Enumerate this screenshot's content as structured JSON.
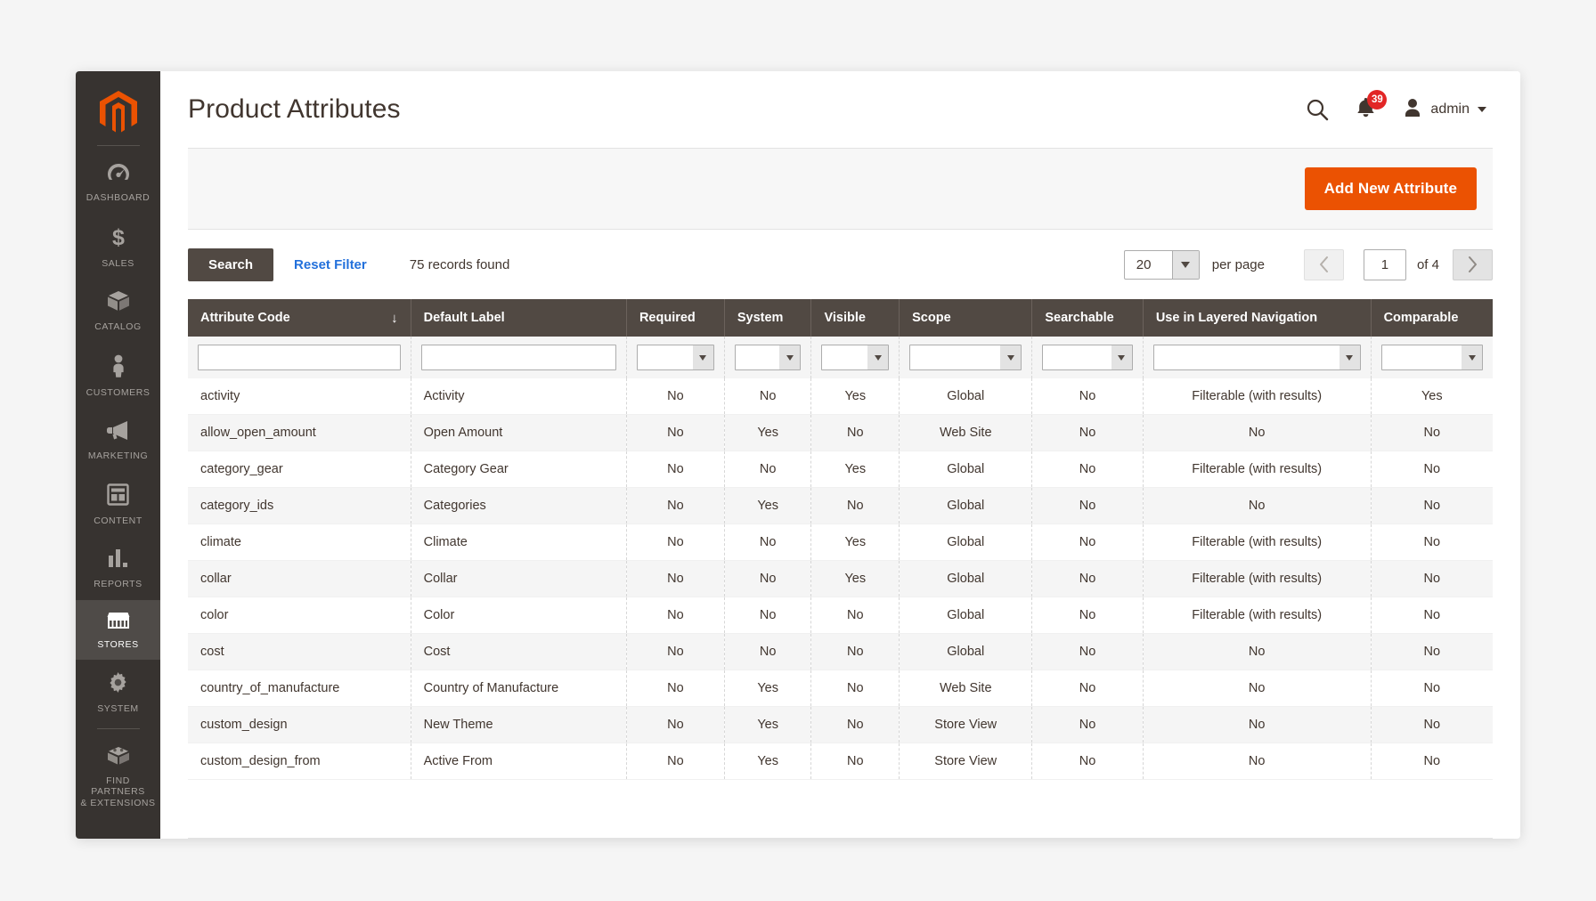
{
  "app": {
    "logo_icon": "magento-logo",
    "accent_color": "#eb5202",
    "sidebar_bg": "#373330",
    "header_bg": "#514943"
  },
  "sidebar": {
    "items": [
      {
        "label": "DASHBOARD",
        "icon": "dashboard-gauge-icon",
        "active": false
      },
      {
        "label": "SALES",
        "icon": "dollar-sign-icon",
        "active": false
      },
      {
        "label": "CATALOG",
        "icon": "box-icon",
        "active": false
      },
      {
        "label": "CUSTOMERS",
        "icon": "person-icon",
        "active": false
      },
      {
        "label": "MARKETING",
        "icon": "megaphone-icon",
        "active": false
      },
      {
        "label": "CONTENT",
        "icon": "layout-window-icon",
        "active": false
      },
      {
        "label": "REPORTS",
        "icon": "bar-chart-icon",
        "active": false
      },
      {
        "label": "STORES",
        "icon": "storefront-icon",
        "active": true
      },
      {
        "label": "SYSTEM",
        "icon": "gear-icon",
        "active": false
      },
      {
        "label": "FIND PARTNERS\n& EXTENSIONS",
        "icon": "puzzle-block-icon",
        "active": false
      }
    ],
    "find_partners_line1": "FIND PARTNERS",
    "find_partners_line2": "& EXTENSIONS"
  },
  "header": {
    "title": "Product Attributes",
    "search_icon": "search-icon",
    "notifications_icon": "bell-icon",
    "notifications_count": "39",
    "user_icon": "user-avatar-icon",
    "user_name": "admin",
    "user_caret_icon": "chevron-down-icon"
  },
  "toolbar": {
    "add_new_attribute_label": "Add New Attribute"
  },
  "grid_controls": {
    "search_label": "Search",
    "reset_filter_label": "Reset Filter",
    "records_found": "75 records found",
    "per_page_value": "20",
    "per_page_label": "per page",
    "prev_icon": "chevron-left-icon",
    "next_icon": "chevron-right-icon",
    "page_value": "1",
    "of_pages": "of 4"
  },
  "grid": {
    "columns": [
      {
        "label": "Attribute Code",
        "sorted": true,
        "sort_icon": "arrow-down-icon",
        "filter_type": "text",
        "align": "left"
      },
      {
        "label": "Default Label",
        "sorted": false,
        "filter_type": "text",
        "align": "left"
      },
      {
        "label": "Required",
        "sorted": false,
        "filter_type": "select",
        "align": "center"
      },
      {
        "label": "System",
        "sorted": false,
        "filter_type": "select",
        "align": "center"
      },
      {
        "label": "Visible",
        "sorted": false,
        "filter_type": "select",
        "align": "center"
      },
      {
        "label": "Scope",
        "sorted": false,
        "filter_type": "select",
        "align": "center"
      },
      {
        "label": "Searchable",
        "sorted": false,
        "filter_type": "select",
        "align": "center"
      },
      {
        "label": "Use in Layered Navigation",
        "sorted": false,
        "filter_type": "select",
        "align": "center"
      },
      {
        "label": "Comparable",
        "sorted": false,
        "filter_type": "select",
        "align": "center"
      }
    ],
    "filter_values": [
      "",
      "",
      "",
      "",
      "",
      "",
      "",
      "",
      ""
    ],
    "rows": [
      [
        "activity",
        "Activity",
        "No",
        "No",
        "Yes",
        "Global",
        "No",
        "Filterable (with results)",
        "Yes"
      ],
      [
        "allow_open_amount",
        "Open Amount",
        "No",
        "Yes",
        "No",
        "Web Site",
        "No",
        "No",
        "No"
      ],
      [
        "category_gear",
        "Category Gear",
        "No",
        "No",
        "Yes",
        "Global",
        "No",
        "Filterable (with results)",
        "No"
      ],
      [
        "category_ids",
        "Categories",
        "No",
        "Yes",
        "No",
        "Global",
        "No",
        "No",
        "No"
      ],
      [
        "climate",
        "Climate",
        "No",
        "No",
        "Yes",
        "Global",
        "No",
        "Filterable (with results)",
        "No"
      ],
      [
        "collar",
        "Collar",
        "No",
        "No",
        "Yes",
        "Global",
        "No",
        "Filterable (with results)",
        "No"
      ],
      [
        "color",
        "Color",
        "No",
        "No",
        "No",
        "Global",
        "No",
        "Filterable (with results)",
        "No"
      ],
      [
        "cost",
        "Cost",
        "No",
        "No",
        "No",
        "Global",
        "No",
        "No",
        "No"
      ],
      [
        "country_of_manufacture",
        "Country of Manufacture",
        "No",
        "Yes",
        "No",
        "Web Site",
        "No",
        "No",
        "No"
      ],
      [
        "custom_design",
        "New Theme",
        "No",
        "Yes",
        "No",
        "Store View",
        "No",
        "No",
        "No"
      ],
      [
        "custom_design_from",
        "Active From",
        "No",
        "Yes",
        "No",
        "Store View",
        "No",
        "No",
        "No"
      ]
    ]
  }
}
